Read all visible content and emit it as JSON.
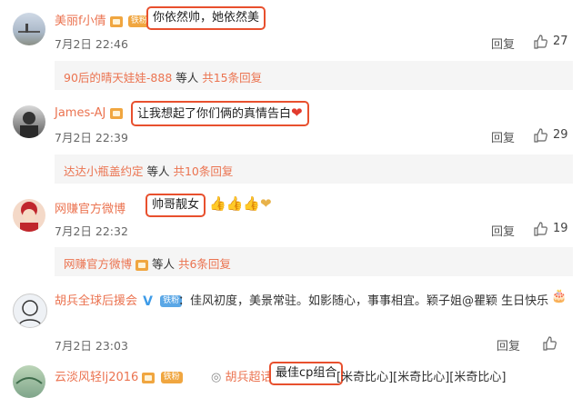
{
  "comments": [
    {
      "username": "美丽f小倩",
      "fan_badge": "铁粉",
      "text": "你依然帅，她依然美",
      "timestamp": "7月2日 22:46",
      "reply_label": "回复",
      "likes": "27",
      "thread": {
        "user": "90后的晴天娃娃-888",
        "suffix_a": " 等人 ",
        "suffix_b": "共15条回复"
      }
    },
    {
      "username": "James-AJ",
      "text": "让我想起了你们俩的真情告白",
      "emoji": "❤",
      "timestamp": "7月2日 22:39",
      "reply_label": "回复",
      "likes": "29",
      "thread": {
        "user": "达达小瓶盖约定",
        "suffix_a": " 等人 ",
        "suffix_b": "共10条回复"
      }
    },
    {
      "username": "网赚官方微博",
      "text": "帅哥靓女",
      "emoji": "👍👍👍❤",
      "timestamp": "7月2日 22:32",
      "reply_label": "回复",
      "likes": "19",
      "thread": {
        "user": "网赚官方微博",
        "suffix_a": " 等人 ",
        "suffix_b": "共6条回复"
      }
    },
    {
      "username": "胡兵全球后援会",
      "fan_badge": "铁粉",
      "text": "：佳风初度，美景常驻。如影随心，事事相宜。颖子姐@瞿颖 生日快乐",
      "cake": "🎂",
      "timestamp": "7月2日 23:03",
      "reply_label": "回复",
      "likes": "",
      "reply_label_short": "回复"
    },
    {
      "username": "云淡风轻lj2016",
      "fan_badge": "铁粉",
      "repost_user": "胡兵超话",
      "highlight": "最佳cp组合",
      "trailing": "[米奇比心][米奇比心][米奇比心]"
    }
  ]
}
